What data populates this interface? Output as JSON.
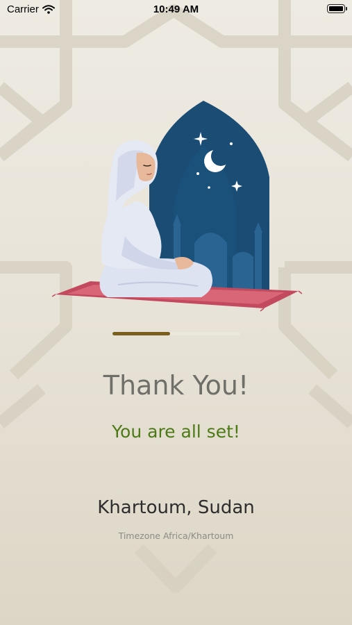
{
  "status_bar": {
    "carrier": "Carrier",
    "time": "10:49 AM",
    "icons": [
      "wifi-icon",
      "battery-icon"
    ]
  },
  "onboarding": {
    "progress": 0.45,
    "progress_color": "#7a5e1e",
    "title": "Thank You!",
    "subtitle": "You are all set!",
    "subtitle_color": "#4c7a16",
    "location": "Khartoum, Sudan",
    "timezone": "Timezone Africa/Khartoum"
  },
  "illustration": {
    "name": "praying-woman-illustration",
    "colors": {
      "window": "#1a4c74",
      "rug": "#c34a5e",
      "robe": "#dde3f1"
    }
  }
}
